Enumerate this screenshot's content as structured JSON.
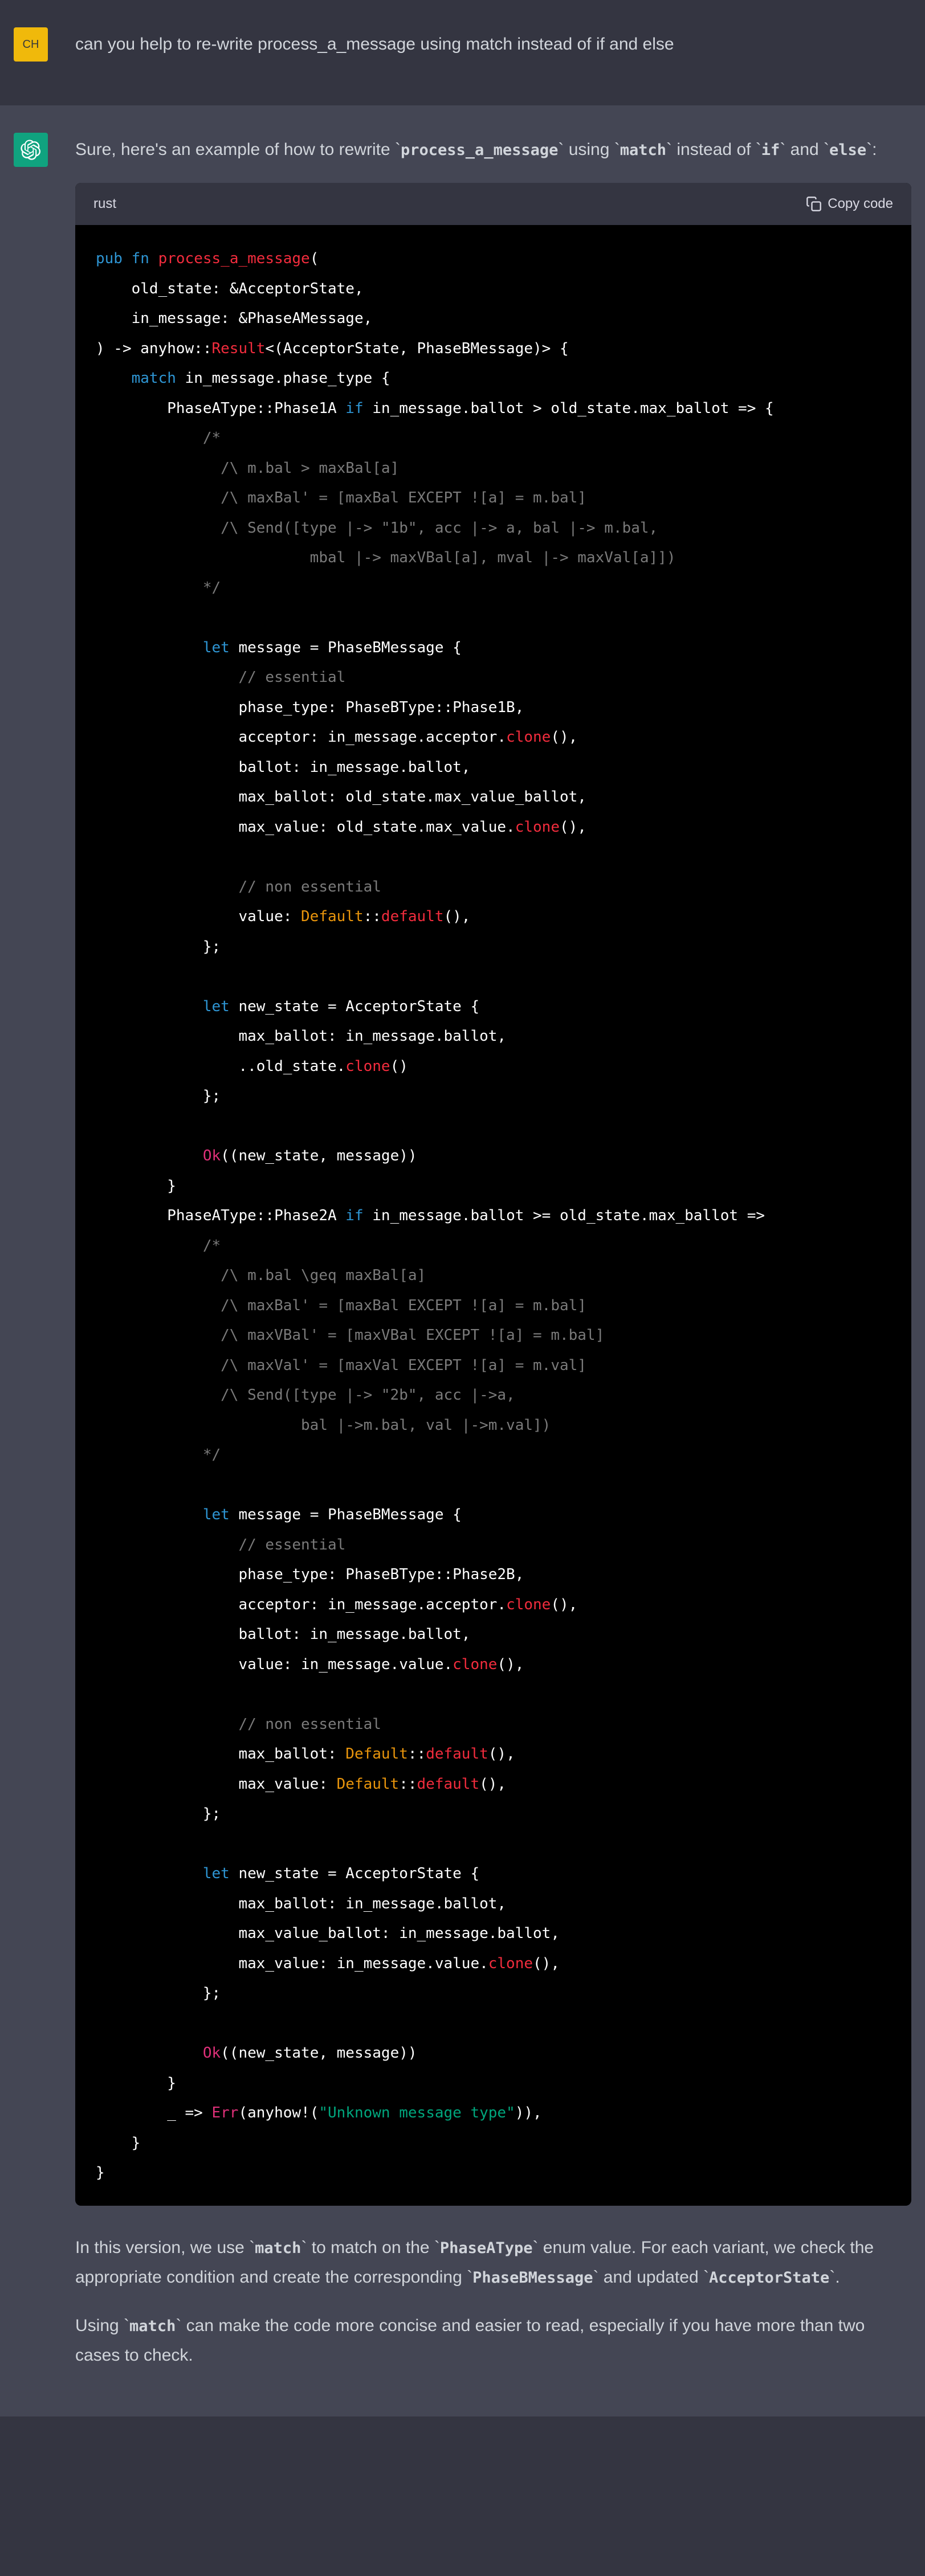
{
  "user_message": "can you help to re-write process_a_message using match instead of if and else",
  "user_avatar_initials": "CH",
  "assistant_intro_pre": "Sure, here's an example of how to rewrite ",
  "assistant_intro_code1": "process_a_message",
  "assistant_intro_mid1": " using ",
  "assistant_intro_code2": "match",
  "assistant_intro_mid2": " instead of ",
  "assistant_intro_code3": "if",
  "assistant_intro_mid3": " and ",
  "assistant_intro_code4": "else",
  "assistant_intro_post": ":",
  "code_lang": "rust",
  "copy_label": "Copy code",
  "outro_p1_pre": "In this version, we use ",
  "outro_p1_c1": "match",
  "outro_p1_m1": " to match on the ",
  "outro_p1_c2": "PhaseAType",
  "outro_p1_m2": " enum value. For each variant, we check the appropriate condition and create the corresponding ",
  "outro_p1_c3": "PhaseBMessage",
  "outro_p1_m3": " and updated ",
  "outro_p1_c4": "AcceptorState",
  "outro_p1_post": ".",
  "outro_p2_pre": "Using ",
  "outro_p2_c1": "match",
  "outro_p2_post": " can make the code more concise and easier to read, especially if you have more than two cases to check.",
  "code": {
    "l1_kw1": "pub",
    "l1_kw2": "fn",
    "l1_fn": "process_a_message",
    "l1_p": "(",
    "l2": "    old_state: &AcceptorState,",
    "l3": "    in_message: &PhaseAMessage,",
    "l4_a": ") -> anyhow::",
    "l4_b": "Result",
    "l4_c": "<(AcceptorState, PhaseBMessage)> {",
    "l5_a": "    ",
    "l5_kw": "match",
    "l5_b": " in_message.phase_type {",
    "l6_a": "        PhaseAType::Phase1A ",
    "l6_kw": "if",
    "l6_b": " in_message.ballot > old_state.max_ballot => {",
    "l7": "            /*",
    "l8": "              /\\ m.bal > maxBal[a]",
    "l9": "              /\\ maxBal' = [maxBal EXCEPT ![a] = m.bal]",
    "l10": "              /\\ Send([type |-> \"1b\", acc |-> a, bal |-> m.bal,",
    "l11": "                        mbal |-> maxVBal[a], mval |-> maxVal[a]])",
    "l12": "            */",
    "l14_a": "            ",
    "l14_kw": "let",
    "l14_b": " message = PhaseBMessage {",
    "l15": "                // essential",
    "l16": "                phase_type: PhaseBType::Phase1B,",
    "l17_a": "                acceptor: in_message.acceptor.",
    "l17_m": "clone",
    "l17_b": "(),",
    "l18": "                ballot: in_message.ballot,",
    "l19": "                max_ballot: old_state.max_value_ballot,",
    "l20_a": "                max_value: old_state.max_value.",
    "l20_m": "clone",
    "l20_b": "(),",
    "l22": "                // non essential",
    "l23_a": "                value: ",
    "l23_d": "Default",
    "l23_b": "::",
    "l23_m": "default",
    "l23_c": "(),",
    "l24": "            };",
    "l26_a": "            ",
    "l26_kw": "let",
    "l26_b": " new_state = AcceptorState {",
    "l27": "                max_ballot: in_message.ballot,",
    "l28_a": "                ..old_state.",
    "l28_m": "clone",
    "l28_b": "()",
    "l29": "            };",
    "l31_a": "            ",
    "l31_ok": "Ok",
    "l31_b": "((new_state, message))",
    "l32": "        }",
    "l33_a": "        PhaseAType::Phase2A ",
    "l33_kw": "if",
    "l33_b": " in_message.ballot >= old_state.max_ballot =>",
    "l34": "            /*",
    "l35": "              /\\ m.bal \\geq maxBal[a]",
    "l36": "              /\\ maxBal' = [maxBal EXCEPT ![a] = m.bal]",
    "l37": "              /\\ maxVBal' = [maxVBal EXCEPT ![a] = m.bal]",
    "l38": "              /\\ maxVal' = [maxVal EXCEPT ![a] = m.val]",
    "l39": "              /\\ Send([type |-> \"2b\", acc |->a,",
    "l40": "                       bal |->m.bal, val |->m.val])",
    "l41": "            */",
    "l43_a": "            ",
    "l43_kw": "let",
    "l43_b": " message = PhaseBMessage {",
    "l44": "                // essential",
    "l45": "                phase_type: PhaseBType::Phase2B,",
    "l46_a": "                acceptor: in_message.acceptor.",
    "l46_m": "clone",
    "l46_b": "(),",
    "l47": "                ballot: in_message.ballot,",
    "l48_a": "                value: in_message.value.",
    "l48_m": "clone",
    "l48_b": "(),",
    "l50": "                // non essential",
    "l51_a": "                max_ballot: ",
    "l51_d": "Default",
    "l51_b": "::",
    "l51_m": "default",
    "l51_c": "(),",
    "l52_a": "                max_value: ",
    "l52_d": "Default",
    "l52_b": "::",
    "l52_m": "default",
    "l52_c": "(),",
    "l53": "            };",
    "l55_a": "            ",
    "l55_kw": "let",
    "l55_b": " new_state = AcceptorState {",
    "l56": "                max_ballot: in_message.ballot,",
    "l57": "                max_value_ballot: in_message.ballot,",
    "l58_a": "                max_value: in_message.value.",
    "l58_m": "clone",
    "l58_b": "(),",
    "l59": "            };",
    "l61_a": "            ",
    "l61_ok": "Ok",
    "l61_b": "((new_state, message))",
    "l62": "        }",
    "l63_a": "        _ => ",
    "l63_err": "Err",
    "l63_b": "(anyhow!(",
    "l63_s": "\"Unknown message type\"",
    "l63_c": ")),",
    "l64": "    }",
    "l65": "}"
  }
}
